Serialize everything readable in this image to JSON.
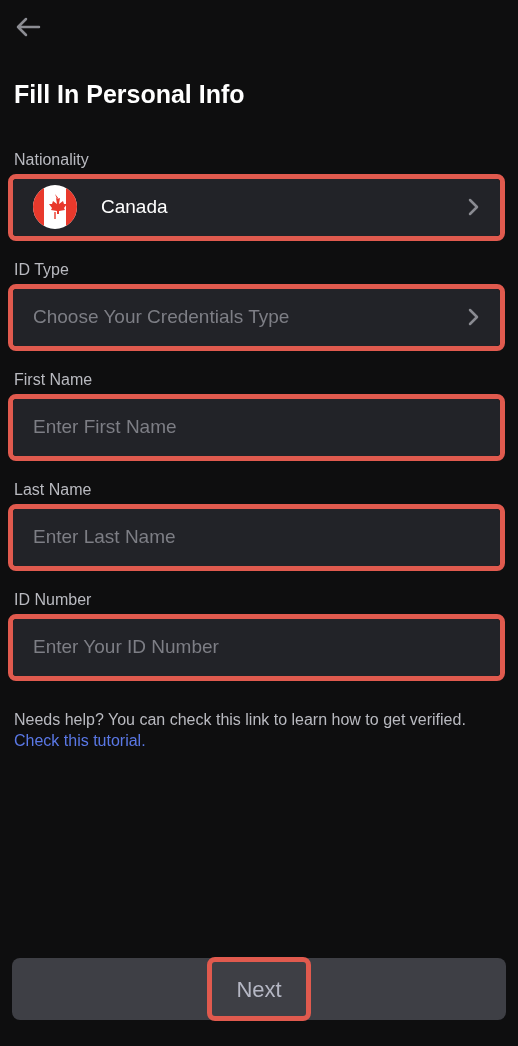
{
  "title": "Fill In Personal Info",
  "fields": [
    {
      "kind": "select",
      "label": "Nationality",
      "value": "Canada",
      "flag": true,
      "highlighted": true
    },
    {
      "kind": "select",
      "label": "ID Type",
      "placeholder": "Choose Your Credentials Type",
      "highlighted": true
    },
    {
      "kind": "input",
      "label": "First Name",
      "placeholder": "Enter First Name",
      "highlighted": true
    },
    {
      "kind": "input",
      "label": "Last Name",
      "placeholder": "Enter Last Name",
      "highlighted": true
    },
    {
      "kind": "input",
      "label": "ID Number",
      "placeholder": "Enter Your ID Number",
      "highlighted": true
    }
  ],
  "help": {
    "text": "Needs help? You can check this link to learn how to get verified.",
    "link": "Check this tutorial."
  },
  "next_button": {
    "label": "Next",
    "highlighted": true
  }
}
